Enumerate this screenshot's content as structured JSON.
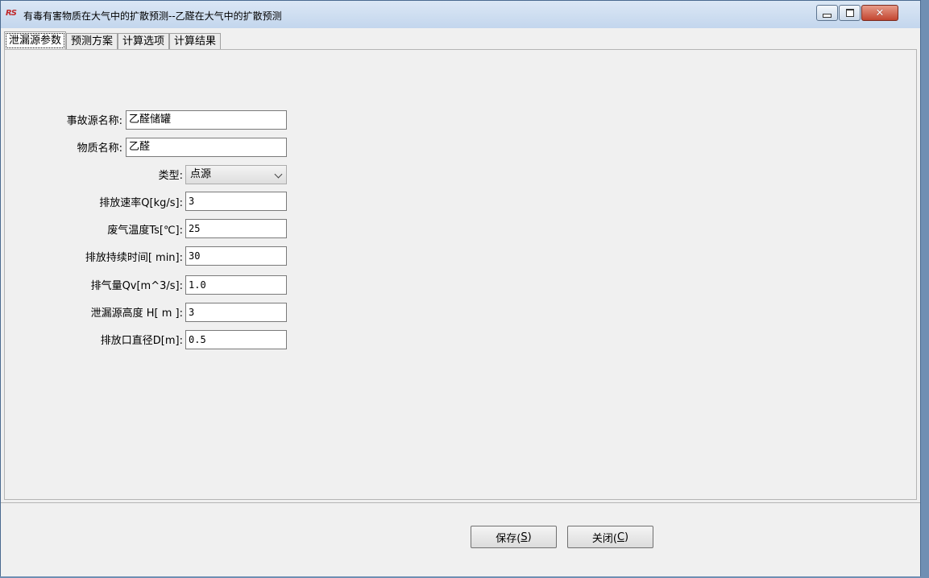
{
  "window": {
    "app_logo": "RS",
    "title": "有毒有害物质在大气中的扩散预测--乙醛在大气中的扩散预测",
    "controls": {
      "minimize": "minimize-icon",
      "maximize": "maximize-icon",
      "close": "close-icon"
    }
  },
  "tabs": [
    {
      "label": "泄漏源参数",
      "active": true
    },
    {
      "label": "预测方案",
      "active": false
    },
    {
      "label": "计算选项",
      "active": false
    },
    {
      "label": "计算结果",
      "active": false
    }
  ],
  "form": {
    "accident_source": {
      "label": "事故源名称:",
      "value": "乙醛储罐"
    },
    "substance": {
      "label": "物质名称:",
      "value": "乙醛"
    },
    "type": {
      "label": "类型:",
      "value": "点源"
    },
    "emission_rate": {
      "label": "排放速率Q[kg/s]:",
      "value": "3"
    },
    "gas_temp": {
      "label": "废气温度Ts[℃]:",
      "value": "25"
    },
    "duration": {
      "label": "排放持续时间[ min]:",
      "value": "30"
    },
    "gas_volume": {
      "label": "排气量Qv[m^3/s]:",
      "value": "1.0"
    },
    "source_height": {
      "label": "泄漏源高度 H[  m ]:",
      "value": "3"
    },
    "outlet_diameter": {
      "label": "排放口直径D[m]:",
      "value": "0.5"
    }
  },
  "buttons": {
    "save": {
      "text": "保存(",
      "key": "S",
      "end": ")"
    },
    "close": {
      "text": "关闭(",
      "key": "C",
      "end": ")"
    }
  }
}
